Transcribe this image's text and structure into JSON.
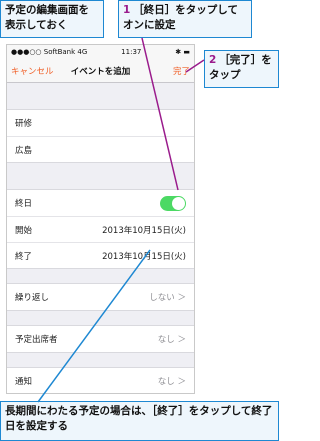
{
  "callouts": {
    "top_left": "予定の編集画面を表示しておく",
    "step1_num": "1",
    "step1_text": "［終日］をタップしてオンに設定",
    "step2_num": "2",
    "step2_text": "［完了］をタップ",
    "bottom": "長期間にわたる予定の場合は、［終了］をタップして終了日を設定する"
  },
  "status_bar": {
    "carrier": "●●●○○ SoftBank 4G",
    "time": "11:37"
  },
  "nav": {
    "cancel": "キャンセル",
    "title": "イベントを追加",
    "done": "完了"
  },
  "fields": {
    "title": "研修",
    "location": "広島"
  },
  "allday": {
    "label": "終日",
    "on": true
  },
  "start": {
    "label": "開始",
    "value": "2013年10月15日(火)"
  },
  "end": {
    "label": "終了",
    "value": "2013年10月15日(火)"
  },
  "repeat": {
    "label": "繰り返し",
    "value": "しない ＞"
  },
  "invitees": {
    "label": "予定出席者",
    "value": "なし ＞"
  },
  "alert": {
    "label": "通知",
    "value": "なし ＞"
  },
  "colors": {
    "accent": "#f05d24",
    "toggle": "#4cd964",
    "callout_border": "#1e88d2",
    "step_number": "#9a1b8c"
  }
}
